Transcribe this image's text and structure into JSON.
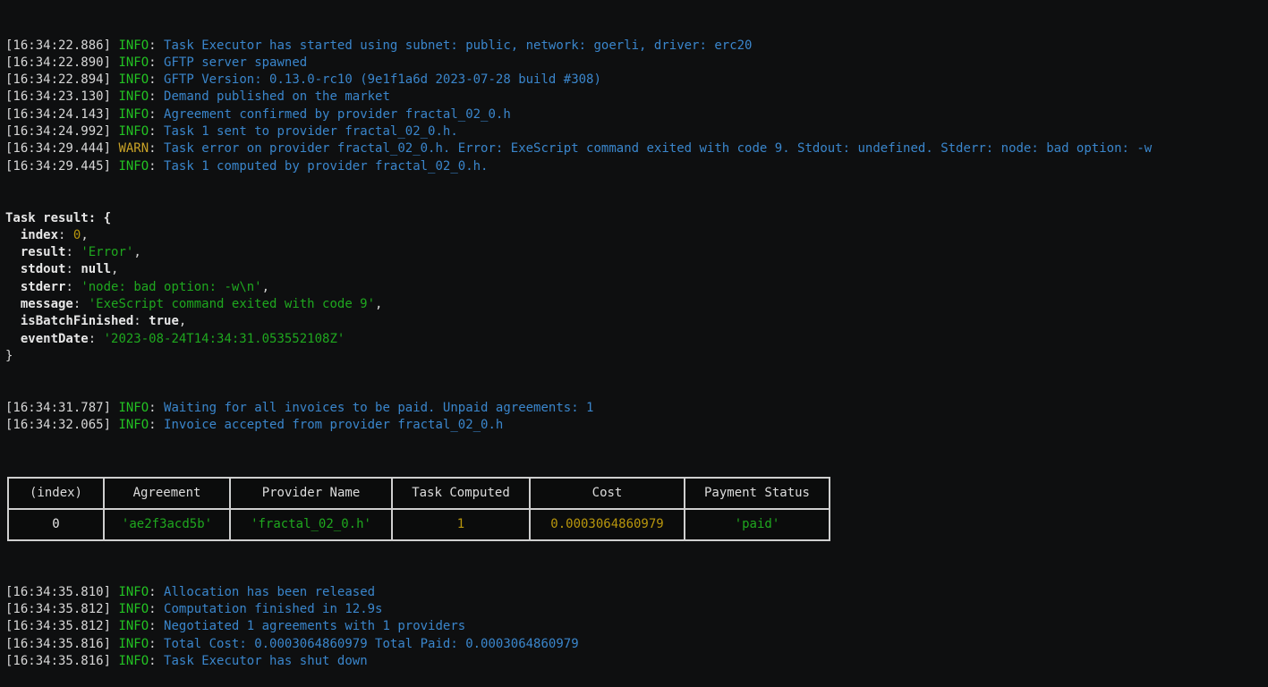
{
  "terminal": {
    "prompt_char": "",
    "log_lines": [
      {
        "timestamp": "[16:34:22.886]",
        "level": "INFO",
        "message": "Task Executor has started using subnet: public, network: goerli, driver: erc20"
      },
      {
        "timestamp": "[16:34:22.890]",
        "level": "INFO",
        "message": "GFTP server spawned"
      },
      {
        "timestamp": "[16:34:22.894]",
        "level": "INFO",
        "message": "GFTP Version: 0.13.0-rc10 (9e1f1a6d 2023-07-28 build #308)"
      },
      {
        "timestamp": "[16:34:23.130]",
        "level": "INFO",
        "message": "Demand published on the market"
      },
      {
        "timestamp": "[16:34:24.143]",
        "level": "INFO",
        "message": "Agreement confirmed by provider fractal_02_0.h"
      },
      {
        "timestamp": "[16:34:24.992]",
        "level": "INFO",
        "message": "Task 1 sent to provider fractal_02_0.h."
      },
      {
        "timestamp": "[16:34:29.444]",
        "level": "WARN",
        "message": "Task error on provider fractal_02_0.h. Error: ExeScript command exited with code 9. Stdout: undefined. Stderr: node: bad option: -w"
      },
      {
        "timestamp": "[16:34:29.445]",
        "level": "INFO",
        "message": "Task 1 computed by provider fractal_02_0.h."
      }
    ],
    "task_result": {
      "header": "Task result: {",
      "footer": "}",
      "entries": [
        {
          "key": "index",
          "value": "0",
          "kind": "num",
          "trailing": ","
        },
        {
          "key": "result",
          "value": "'Error'",
          "kind": "str",
          "trailing": ","
        },
        {
          "key": "stdout",
          "value": "null",
          "kind": "lit",
          "trailing": ","
        },
        {
          "key": "stderr",
          "value": "'node: bad option: -w\\n'",
          "kind": "str",
          "trailing": ","
        },
        {
          "key": "message",
          "value": "'ExeScript command exited with code 9'",
          "kind": "str",
          "trailing": ","
        },
        {
          "key": "isBatchFinished",
          "value": "true",
          "kind": "lit",
          "trailing": ","
        },
        {
          "key": "eventDate",
          "value": "'2023-08-24T14:34:31.053552108Z'",
          "kind": "str",
          "trailing": ""
        }
      ]
    },
    "log_lines_mid": [
      {
        "timestamp": "[16:34:31.787]",
        "level": "INFO",
        "message": "Waiting for all invoices to be paid. Unpaid agreements: 1"
      },
      {
        "timestamp": "[16:34:32.065]",
        "level": "INFO",
        "message": "Invoice accepted from provider fractal_02_0.h"
      }
    ],
    "summary_table": {
      "headers": [
        "(index)",
        "Agreement",
        "Provider Name",
        "Task Computed",
        "Cost",
        "Payment Status"
      ],
      "rows": [
        {
          "cells": [
            {
              "text": "0",
              "kind": "index"
            },
            {
              "text": "'ae2f3acd5b'",
              "kind": "str"
            },
            {
              "text": "'fractal_02_0.h'",
              "kind": "str"
            },
            {
              "text": "1",
              "kind": "num"
            },
            {
              "text": "0.0003064860979",
              "kind": "num"
            },
            {
              "text": "'paid'",
              "kind": "str"
            }
          ]
        }
      ]
    },
    "log_lines_tail": [
      {
        "timestamp": "[16:34:35.810]",
        "level": "INFO",
        "message": "Allocation has been released"
      },
      {
        "timestamp": "[16:34:35.812]",
        "level": "INFO",
        "message": "Computation finished in 12.9s"
      },
      {
        "timestamp": "[16:34:35.812]",
        "level": "INFO",
        "message": "Negotiated 1 agreements with 1 providers"
      },
      {
        "timestamp": "[16:34:35.816]",
        "level": "INFO",
        "message": "Total Cost: 0.0003064860979 Total Paid: 0.0003064860979"
      },
      {
        "timestamp": "[16:34:35.816]",
        "level": "INFO",
        "message": "Task Executor has shut down"
      }
    ]
  },
  "colors": {
    "background": "#0e0f10",
    "timestamp": "#d7d7d7",
    "info": "#23c223",
    "warn": "#c9a227",
    "message": "#3a86cc",
    "string": "#1fa81f",
    "number": "#b8960c",
    "literal": "#e6e6e6",
    "table_border": "#cfcfcf"
  }
}
